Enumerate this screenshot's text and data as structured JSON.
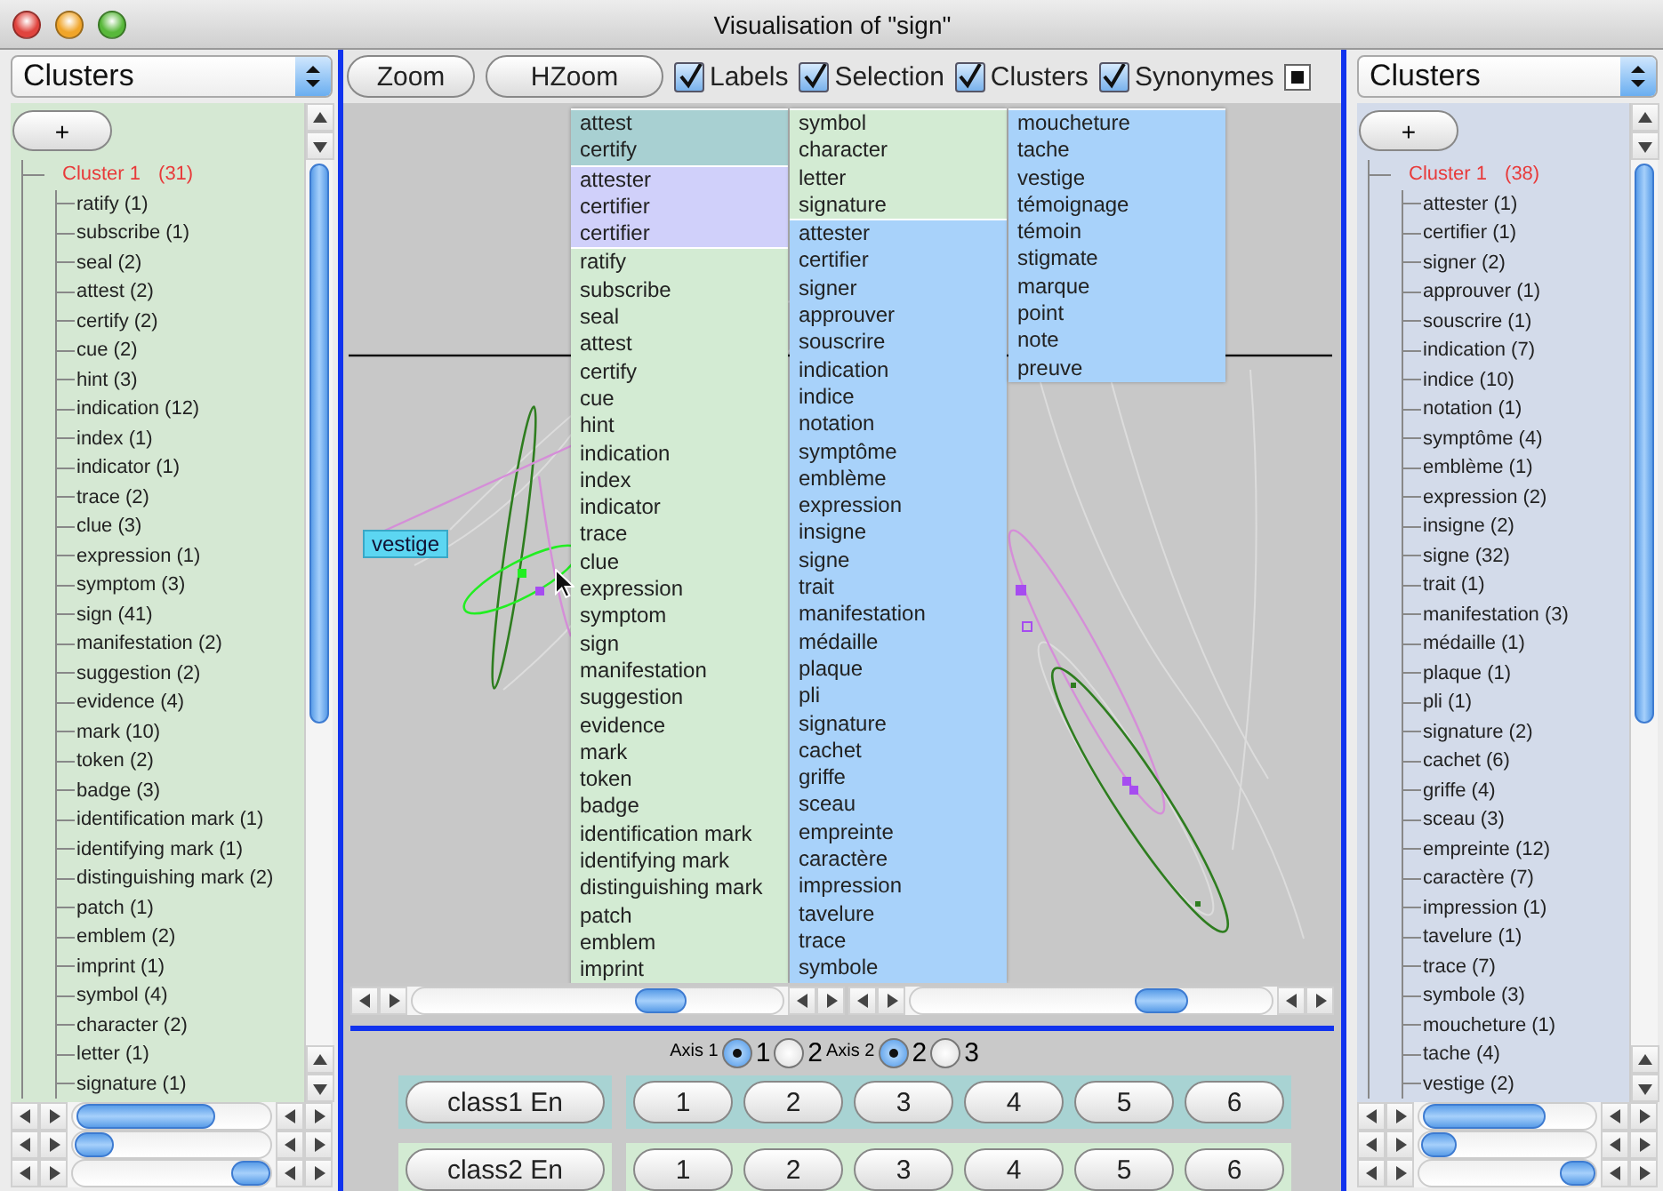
{
  "window": {
    "title": "Visualisation of \"sign\""
  },
  "left_panel": {
    "selector": "Clusters",
    "add_button": "+",
    "tree": [
      {
        "label": "Cluster 1",
        "count": "(31)",
        "expanded": true,
        "children": [
          {
            "label": "ratify (1)"
          },
          {
            "label": "subscribe (1)"
          },
          {
            "label": "seal (2)"
          },
          {
            "label": "attest (2)"
          },
          {
            "label": "certify (2)"
          },
          {
            "label": "cue (2)"
          },
          {
            "label": "hint (3)"
          },
          {
            "label": "indication (12)"
          },
          {
            "label": "index (1)"
          },
          {
            "label": "indicator (1)"
          },
          {
            "label": "trace (2)"
          },
          {
            "label": "clue (3)"
          },
          {
            "label": "expression (1)"
          },
          {
            "label": "symptom (3)"
          },
          {
            "label": "sign (41)"
          },
          {
            "label": "manifestation (2)"
          },
          {
            "label": "suggestion (2)"
          },
          {
            "label": "evidence (4)"
          },
          {
            "label": "mark (10)"
          },
          {
            "label": "token (2)"
          },
          {
            "label": "badge (3)"
          },
          {
            "label": "identification mark (1)"
          },
          {
            "label": "identifying mark (1)"
          },
          {
            "label": "distinguishing mark (2)"
          },
          {
            "label": "patch (1)"
          },
          {
            "label": "emblem (2)"
          },
          {
            "label": "imprint (1)"
          },
          {
            "label": "symbol (4)"
          },
          {
            "label": "character (2)"
          },
          {
            "label": "letter (1)"
          },
          {
            "label": "signature (1)"
          }
        ]
      }
    ]
  },
  "toolbar": {
    "buttons": [
      "Zoom",
      "HZoom"
    ],
    "checkboxes": [
      {
        "label": "Labels",
        "checked": true
      },
      {
        "label": "Selection",
        "checked": true
      },
      {
        "label": "Clusters",
        "checked": true
      },
      {
        "label": "Synonymes",
        "checked": true
      }
    ]
  },
  "plot": {
    "tags": [
      "vestige"
    ]
  },
  "popup": {
    "columns": [
      {
        "groups": [
          {
            "color": "#a8d0d2",
            "items": [
              "attest",
              "certify"
            ]
          },
          {
            "color": "#d0d0fa",
            "items": [
              "attester",
              "certifier",
              "certifier"
            ]
          },
          {
            "color": "#d3ebd3",
            "items": [
              "ratify",
              "subscribe",
              "seal",
              "attest",
              "certify",
              "cue",
              "hint",
              "indication",
              "index",
              "indicator",
              "trace",
              "clue",
              "expression",
              "symptom",
              "sign",
              "manifestation",
              "suggestion",
              "evidence",
              "mark",
              "token",
              "badge",
              "identification mark",
              "identifying mark",
              "distinguishing mark",
              "patch",
              "emblem",
              "imprint"
            ]
          }
        ]
      },
      {
        "groups": [
          {
            "color": "#d3ebd3",
            "items": [
              "symbol",
              "character",
              "letter",
              "signature"
            ]
          },
          {
            "color": "#a8d2fa",
            "items": [
              "attester",
              "certifier",
              "signer",
              "approuver",
              "souscrire",
              "indication",
              "indice",
              "notation",
              "symptôme",
              "emblème",
              "expression",
              "insigne",
              "signe",
              "trait",
              "manifestation",
              "médaille",
              "plaque",
              "pli",
              "signature",
              "cachet",
              "griffe",
              "sceau",
              "empreinte",
              "caractère",
              "impression",
              "tavelure",
              "trace",
              "symbole"
            ]
          }
        ]
      },
      {
        "groups": [
          {
            "color": "#a8d2fa",
            "items": [
              "moucheture",
              "tache",
              "vestige",
              "témoignage",
              "témoin",
              "stigmate",
              "marque",
              "point",
              "note",
              "preuve"
            ]
          }
        ]
      }
    ]
  },
  "axes": [
    {
      "label": "Axis 1",
      "options": [
        {
          "label": "1",
          "selected": true
        },
        {
          "label": "2",
          "selected": false
        }
      ]
    },
    {
      "label": "Axis 2",
      "options": [
        {
          "label": "2",
          "selected": true
        },
        {
          "label": "3",
          "selected": false
        }
      ]
    }
  ],
  "class_rows": [
    {
      "label": "class1 En",
      "color": "#a8d3d3",
      "buttons": [
        "1",
        "2",
        "3",
        "4",
        "5",
        "6"
      ]
    },
    {
      "label": "class2 En",
      "color": "#d3ebd3",
      "buttons": [
        "1",
        "2",
        "3",
        "4",
        "5",
        "6"
      ]
    }
  ],
  "right_panel": {
    "selector": "Clusters",
    "add_button": "+",
    "tree": [
      {
        "label": "Cluster 1",
        "count": "(38)",
        "expanded": true,
        "children": [
          {
            "label": "attester (1)"
          },
          {
            "label": "certifier (1)"
          },
          {
            "label": "signer (2)"
          },
          {
            "label": "approuver (1)"
          },
          {
            "label": "souscrire (1)"
          },
          {
            "label": "indication (7)"
          },
          {
            "label": "indice (10)"
          },
          {
            "label": "notation (1)"
          },
          {
            "label": "symptôme (4)"
          },
          {
            "label": "emblème (1)"
          },
          {
            "label": "expression (2)"
          },
          {
            "label": "insigne (2)"
          },
          {
            "label": "signe (32)"
          },
          {
            "label": "trait (1)"
          },
          {
            "label": "manifestation (3)"
          },
          {
            "label": "médaille (1)"
          },
          {
            "label": "plaque (1)"
          },
          {
            "label": "pli (1)"
          },
          {
            "label": "signature (2)"
          },
          {
            "label": "cachet (6)"
          },
          {
            "label": "griffe (4)"
          },
          {
            "label": "sceau (3)"
          },
          {
            "label": "empreinte (12)"
          },
          {
            "label": "caractère (7)"
          },
          {
            "label": "impression (1)"
          },
          {
            "label": "tavelure (1)"
          },
          {
            "label": "trace (7)"
          },
          {
            "label": "symbole (3)"
          },
          {
            "label": "moucheture (1)"
          },
          {
            "label": "tache (4)"
          },
          {
            "label": "vestige (2)"
          }
        ]
      }
    ]
  }
}
